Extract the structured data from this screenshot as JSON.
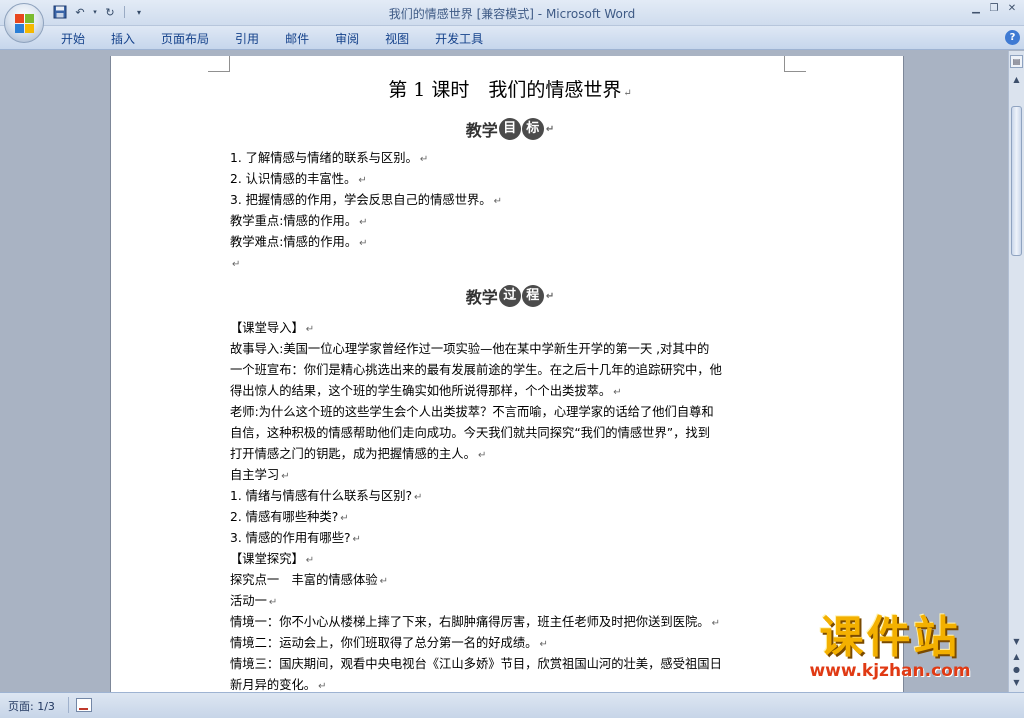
{
  "window": {
    "title_doc": "我们的情感世界 [兼容模式]",
    "title_sep": " - ",
    "title_app": "Microsoft Word",
    "min_icon": "minimize-icon",
    "restore_icon": "restore-icon",
    "close_icon": "close-icon"
  },
  "ribbon": {
    "tabs": [
      "开始",
      "插入",
      "页面布局",
      "引用",
      "邮件",
      "审阅",
      "视图",
      "开发工具"
    ],
    "help": "?"
  },
  "document": {
    "title": "第 1 课时　我们的情感世界",
    "section1": {
      "prefix": "教学",
      "c1": "目",
      "c2": "标"
    },
    "goals": [
      "1. 了解情感与情绪的联系与区别。",
      "2. 认识情感的丰富性。",
      "3. 把握情感的作用，学会反思自己的情感世界。",
      "教学重点:情感的作用。",
      "教学难点:情感的作用。"
    ],
    "section2": {
      "prefix": "教学",
      "c1": "过",
      "c2": "程"
    },
    "process": [
      "【课堂导入】",
      "故事导入:美国一位心理学家曾经作过一项实验—他在某中学新生开学的第一天 ,对其中的",
      "一个班宣布：你们是精心挑选出来的最有发展前途的学生。在之后十几年的追踪研究中，他",
      "得出惊人的结果，这个班的学生确实如他所说得那样，个个出类拔萃。",
      "老师:为什么这个班的这些学生会个人出类拔萃？不言而喻，心理学家的话给了他们自尊和",
      "自信，这种积极的情感帮助他们走向成功。今天我们就共同探究“我们的情感世界”，找到",
      "打开情感之门的钥匙，成为把握情感的主人。",
      "自主学习",
      "1. 情绪与情感有什么联系与区别?",
      "2. 情感有哪些种类?",
      "3. 情感的作用有哪些?",
      "【课堂探究】",
      "探究点一　丰富的情感体验",
      "活动一",
      "情境一：你不小心从楼梯上摔了下来，右脚肿痛得厉害，班主任老师及时把你送到医院。",
      "情境二：运动会上，你们班取得了总分第一名的好成绩。",
      "情境三：国庆期间，观看中央电视台《江山多娇》节目，欣赏祖国山河的壮美，感受祖国日",
      "新月异的变化。"
    ],
    "paragraph_mark": "↵"
  },
  "statusbar": {
    "page": "页面: 1/3"
  },
  "watermark": {
    "text": "课件站",
    "url": "www.kjzhan.com"
  }
}
